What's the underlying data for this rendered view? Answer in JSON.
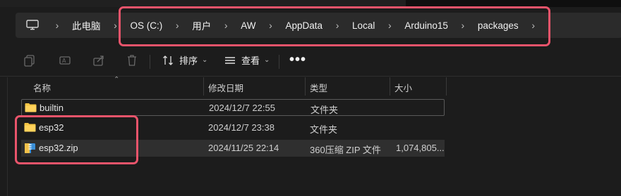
{
  "address_bar": {
    "root_icon": "computer-icon",
    "crumbs": [
      "此电脑",
      "OS (C:)",
      "用户",
      "AW",
      "AppData",
      "Local",
      "Arduino15",
      "packages"
    ]
  },
  "toolbar": {
    "sort_label": "排序",
    "view_label": "查看",
    "more_label": "•••"
  },
  "columns": {
    "name": "名称",
    "date": "修改日期",
    "type": "类型",
    "size": "大小"
  },
  "files": [
    {
      "name": "builtin",
      "date": "2024/12/7 22:55",
      "type": "文件夹",
      "size": "",
      "icon": "folder-icon"
    },
    {
      "name": "esp32",
      "date": "2024/12/7 23:38",
      "type": "文件夹",
      "size": "",
      "icon": "folder-icon"
    },
    {
      "name": "esp32.zip",
      "date": "2024/11/25 22:14",
      "type": "360压缩 ZIP 文件",
      "size": "1,074,805...",
      "icon": "zip-archive-icon"
    }
  ],
  "colors": {
    "accent_highlight": "#e9546b",
    "folder": "#f4c443",
    "background": "#1c1c1c"
  }
}
